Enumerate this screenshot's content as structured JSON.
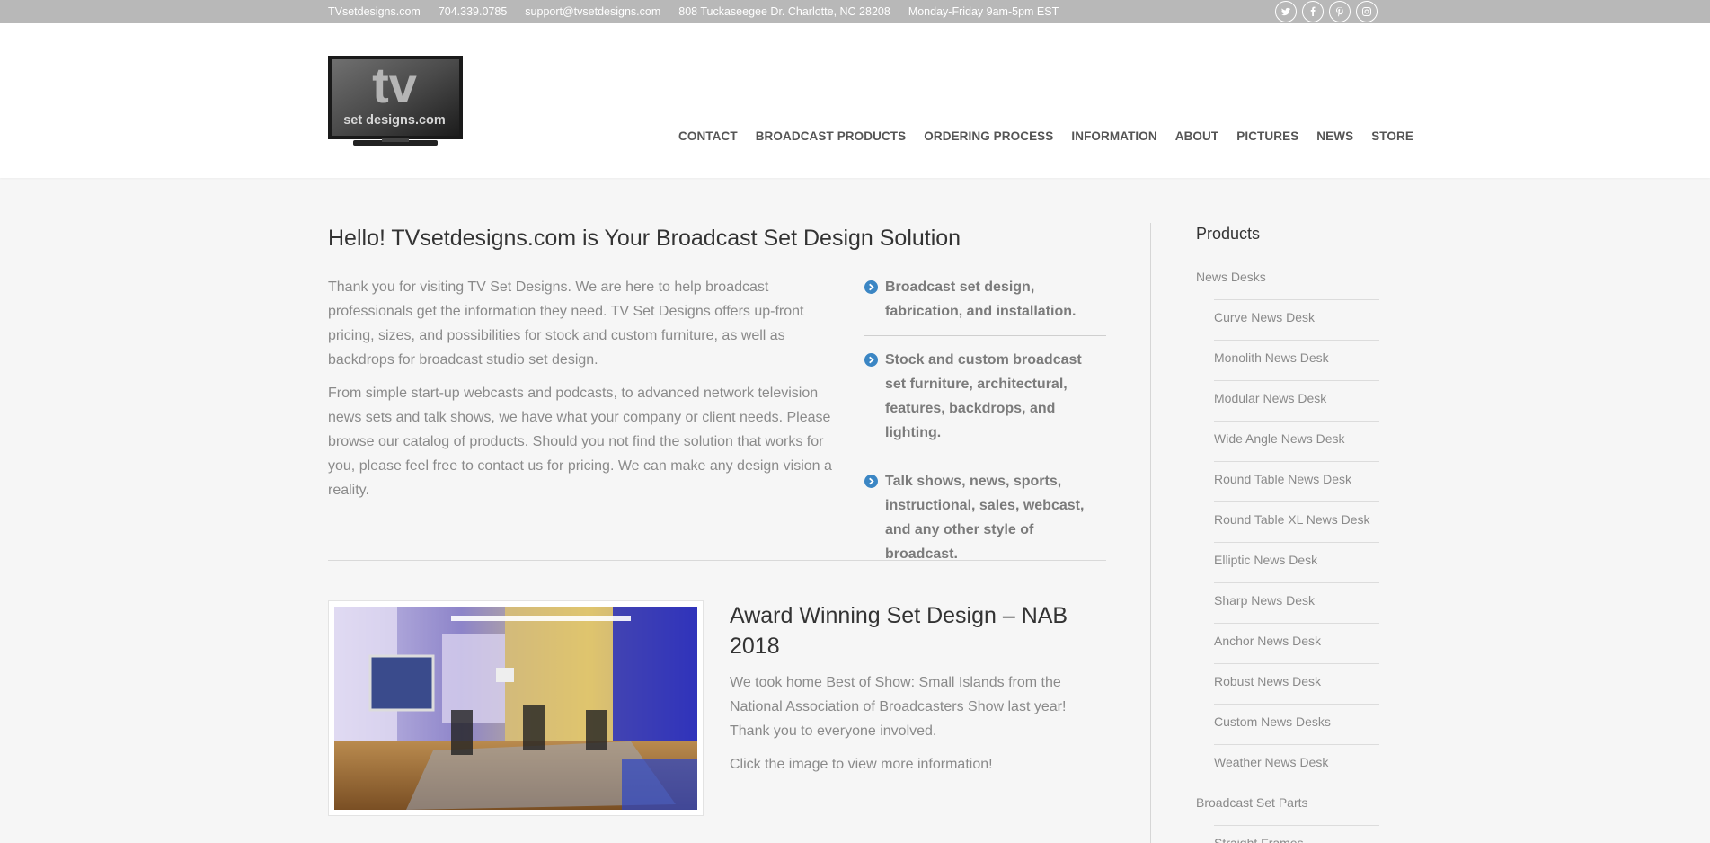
{
  "topbar": {
    "site": "TVsetdesigns.com",
    "phone": "704.339.0785",
    "email": "support@tvsetdesigns.com",
    "address": "808 Tuckaseegee Dr. Charlotte, NC 28208",
    "hours": "Monday-Friday 9am-5pm EST",
    "social": [
      "twitter-icon",
      "facebook-icon",
      "pinterest-icon",
      "instagram-icon"
    ]
  },
  "logo": {
    "line1": "tv",
    "line2": "set designs.com"
  },
  "nav": [
    "CONTACT",
    "BROADCAST PRODUCTS",
    "ORDERING PROCESS",
    "INFORMATION",
    "ABOUT",
    "PICTURES",
    "NEWS",
    "STORE"
  ],
  "main": {
    "title": "Hello! TVsetdesigns.com is Your Broadcast Set Design Solution",
    "intro": [
      "Thank you for visiting TV Set Designs. We are here to help broadcast professionals get the information they need. TV Set Designs offers up-front pricing, sizes, and possibilities for stock and custom furniture, as well as backdrops for broadcast studio set design.",
      "From simple start-up webcasts and podcasts, to advanced network television news sets and talk shows, we have what your company or client needs. Please browse our catalog of products. Should you not find the solution that works for you, please feel free to contact us for pricing. We can make any design vision a reality."
    ],
    "features": [
      "Broadcast set design, fabrication, and installation.",
      "Stock and custom broadcast set furniture, architectural, features, backdrops, and lighting.",
      "Talk shows, news, sports, instructional, sales, webcast, and any other style of broadcast."
    ],
    "award": {
      "title": "Award Winning Set Design – NAB 2018",
      "text": [
        "We took home Best of Show: Small Islands from the National Association of Broadcasters Show last year! Thank you to everyone involved.",
        "Click the image to view more information!"
      ]
    }
  },
  "sidebar": {
    "title": "Products",
    "items": [
      {
        "label": "News Desks",
        "level": 0
      },
      {
        "label": "Curve News Desk",
        "level": 1
      },
      {
        "label": "Monolith News Desk",
        "level": 1
      },
      {
        "label": "Modular News Desk",
        "level": 1
      },
      {
        "label": "Wide Angle News Desk",
        "level": 1
      },
      {
        "label": "Round Table News Desk",
        "level": 1
      },
      {
        "label": "Round Table XL News Desk",
        "level": 1
      },
      {
        "label": "Elliptic News Desk",
        "level": 1
      },
      {
        "label": "Sharp News Desk",
        "level": 1
      },
      {
        "label": "Anchor News Desk",
        "level": 1
      },
      {
        "label": "Robust News Desk",
        "level": 1
      },
      {
        "label": "Custom News Desks",
        "level": 1
      },
      {
        "label": "Weather News Desk",
        "level": 1
      },
      {
        "label": "Broadcast Set Parts",
        "level": 0
      },
      {
        "label": "Straight Frames",
        "level": 1
      }
    ]
  },
  "colors": {
    "accent": "#3b86c4",
    "topbar": "#b8b8b8",
    "heading": "#333333",
    "body": "#8a8a8a"
  }
}
